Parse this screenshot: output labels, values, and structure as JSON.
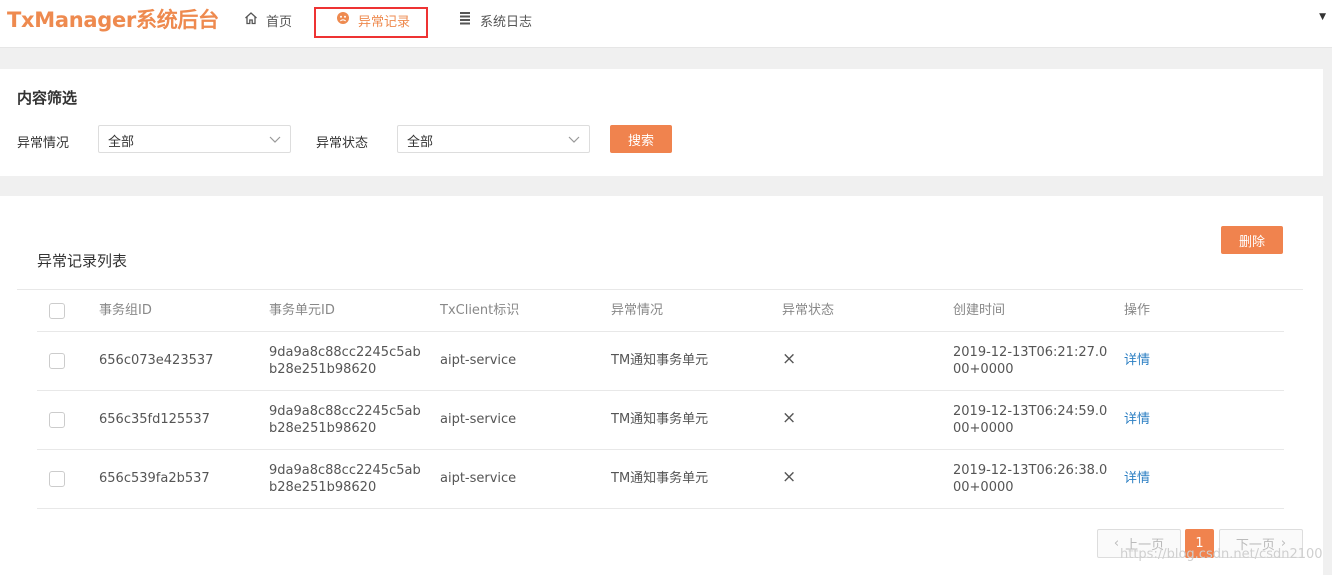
{
  "app": {
    "title": "TxManager系统后台"
  },
  "nav": {
    "items": [
      {
        "label": "首页",
        "icon": "home-icon"
      },
      {
        "label": "异常记录",
        "icon": "exception-icon",
        "active": true
      },
      {
        "label": "系统日志",
        "icon": "list-icon"
      }
    ]
  },
  "filter": {
    "title": "内容筛选",
    "exception_label": "异常情况",
    "exception_value": "全部",
    "status_label": "异常状态",
    "status_value": "全部",
    "search_label": "搜索"
  },
  "list": {
    "title": "异常记录列表",
    "delete_label": "删除",
    "columns": [
      "事务组ID",
      "事务单元ID",
      "TxClient标识",
      "异常情况",
      "异常状态",
      "创建时间",
      "操作"
    ],
    "rows": [
      {
        "group_id": "656c073e423537",
        "unit_id_1": "9da9a8c88cc2245c5ab",
        "unit_id_2": "b28e251b98620",
        "client": "aipt-service",
        "exception": "TM通知事务单元",
        "status": "×",
        "time_1": "2019-12-13T06:21:27.0",
        "time_2": "00+0000",
        "action": "详情"
      },
      {
        "group_id": "656c35fd125537",
        "unit_id_1": "9da9a8c88cc2245c5ab",
        "unit_id_2": "b28e251b98620",
        "client": "aipt-service",
        "exception": "TM通知事务单元",
        "status": "×",
        "time_1": "2019-12-13T06:24:59.0",
        "time_2": "00+0000",
        "action": "详情"
      },
      {
        "group_id": "656c539fa2b537",
        "unit_id_1": "9da9a8c88cc2245c5ab",
        "unit_id_2": "b28e251b98620",
        "client": "aipt-service",
        "exception": "TM通知事务单元",
        "status": "×",
        "time_1": "2019-12-13T06:26:38.0",
        "time_2": "00+0000",
        "action": "详情"
      }
    ]
  },
  "pager": {
    "prev": "上一页",
    "current": "1",
    "next": "下一页"
  },
  "watermark": "https://blog.csdn.net/csdn2100",
  "colors": {
    "accent": "#f0834e",
    "link": "#2c7fc3",
    "highlight": "#ee3333"
  }
}
